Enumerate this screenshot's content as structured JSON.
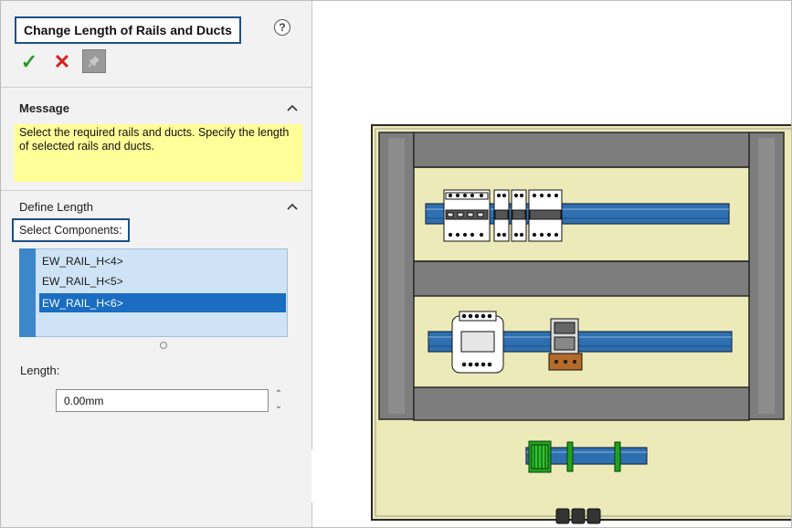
{
  "property_manager": {
    "title": "Change Length of Rails and Ducts",
    "help_icon": "question-circle-icon",
    "toolbar": {
      "ok_icon": "checkmark-icon",
      "ok_glyph": "✓",
      "cancel_icon": "close-icon",
      "cancel_glyph": "✕",
      "pin_icon": "pushpin-icon"
    },
    "message": {
      "title": "Message",
      "text": "Select the required rails and ducts. Specify the length of selected rails and ducts."
    },
    "define_length": {
      "title": "Define Length",
      "select_components_label": "Select Components:",
      "components": [
        {
          "label": "EW_RAIL_H<4>",
          "selected": false
        },
        {
          "label": "EW_RAIL_H<5>",
          "selected": false
        },
        {
          "label": "EW_RAIL_H<6>",
          "selected": true
        }
      ],
      "length_label": "Length:",
      "length_value": "0.00mm"
    }
  },
  "colors": {
    "accent": "#1b4f8a",
    "message_bg": "#ffff99",
    "selection": "#1a6dc0",
    "rail": "#2e6fb0",
    "panel_fill": "#f1edc4",
    "duct": "#7a7a7a"
  }
}
